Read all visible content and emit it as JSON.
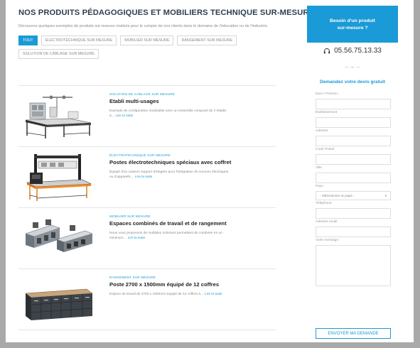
{
  "main": {
    "heading": "NOS PRODUITS PÉDAGOGIQUES ET MOBILIERS TECHNIQUE SUR-MESURE",
    "intro": "Découvrez quelques exemples de produits sur-mesure réalisés pour le compte de nos clients dans le domaine de l'éducation ou de l'industrie.",
    "filters": [
      "TOUT",
      "ÉLECTROTECHNIQUE SUR MESURE",
      "MOBILIER SUR MESURE",
      "RANGEMENT SUR MESURE",
      "SOLUTION DE CÂBLAGE SUR MESURE"
    ],
    "active_filter": "TOUT",
    "products": [
      {
        "category": "SOLUTION DE CÂBLAGE SUR MESURE",
        "title": "Etabli multi-usages",
        "desc": "Exemple de configuration modulable avec un ensemble composé de 2 établis à…",
        "more": "Lire la suite"
      },
      {
        "category": "ÉLECTROTECHNIQUE SUR MESURE",
        "title": "Postes électrotechniques spéciaux avec coffret",
        "desc": "Équipé d'un caisson support d'étagère pour l'intégration de sources électriques ou d'appareils…",
        "more": "Lire la suite"
      },
      {
        "category": "MOBILIER SUR MESURE",
        "title": "Espaces combinés de travail et de rangement",
        "desc": "Nous vous proposons de multiples solutions permettant de combiner en un minimum…",
        "more": "Lire la suite"
      },
      {
        "category": "RANGEMENT SUR MESURE",
        "title": "Poste 2700 x 1500mm équipé de 12 coffres",
        "desc": "Espace de travail de 2700 x 1500mm équipé de 12 coffres à…",
        "more": "Lire la suite"
      }
    ]
  },
  "sidebar": {
    "box_line1": "Besoin d'un produit",
    "box_line2": "sur-mesure ?",
    "phone": "05.56.75.13.33",
    "or": "ou",
    "devis": "Demandez votre devis gratuit",
    "fields": {
      "name": "Nom / Prénom :",
      "company": "Établissement",
      "address": "Adresse",
      "postal": "Code Postal",
      "city": "Ville",
      "country": "Pays :",
      "country_placeholder": "- Sélectionner un pays -",
      "phone": "Téléphone",
      "email": "Adresse email",
      "message": "Votre message :"
    },
    "submit": "ENVOYER MA DEMANDE"
  },
  "colors": {
    "accent": "#1a9ad6",
    "heading": "#2d3e50",
    "backdrop": "#a9a9a9"
  }
}
